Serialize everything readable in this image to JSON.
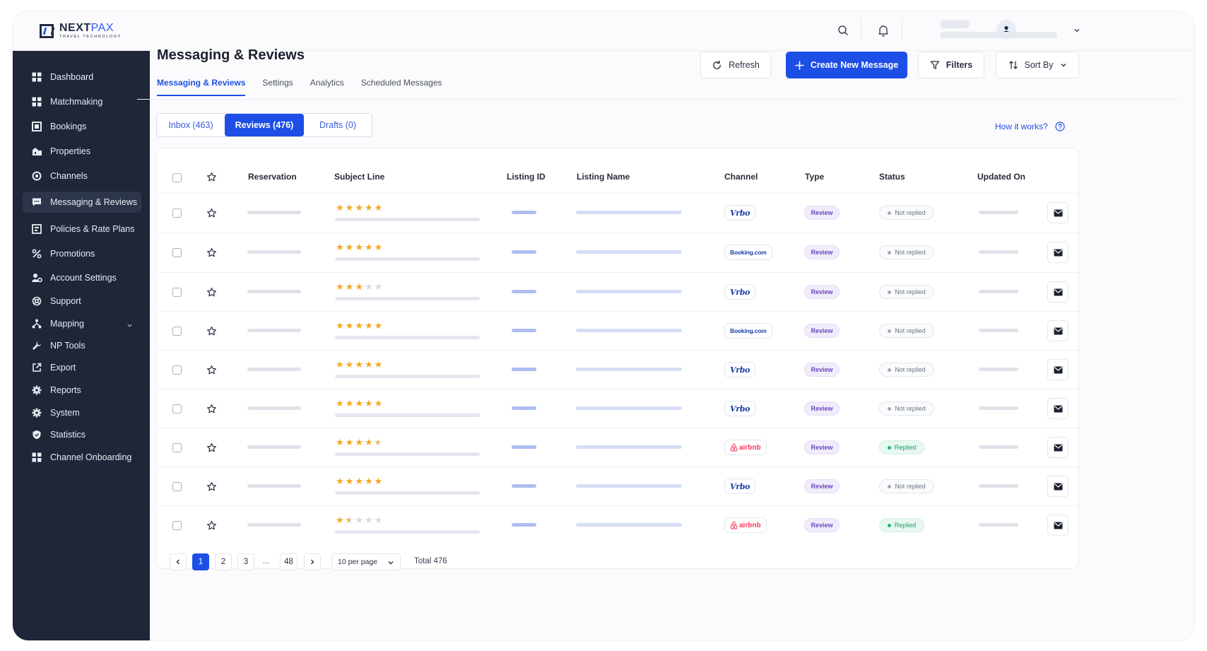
{
  "brand": {
    "name_bold": "NEXT",
    "name_light": "PAX",
    "tagline": "TRAVEL TECHNOLOGY",
    "accent": "#1d4ee6"
  },
  "sidebar": {
    "items": [
      {
        "label": "Dashboard",
        "icon": "grid-icon"
      },
      {
        "label": "Matchmaking",
        "icon": "grid-icon"
      },
      {
        "label": "Bookings",
        "icon": "book-icon"
      },
      {
        "label": "Properties",
        "icon": "building-icon"
      },
      {
        "label": "Channels",
        "icon": "channel-icon"
      },
      {
        "label": "Messaging & Reviews",
        "icon": "chat-icon"
      },
      {
        "label": "Policies & Rate Plans",
        "icon": "policy-icon"
      },
      {
        "label": "Promotions",
        "icon": "promo-icon"
      },
      {
        "label": "Account Settings",
        "icon": "account-gear-icon"
      },
      {
        "label": "Support",
        "icon": "support-icon"
      },
      {
        "label": "Mapping",
        "icon": "mapping-icon"
      },
      {
        "label": "NP Tools",
        "icon": "wrench-icon"
      },
      {
        "label": "Export",
        "icon": "export-icon"
      },
      {
        "label": "Reports",
        "icon": "gear-icon"
      },
      {
        "label": "System",
        "icon": "gear-icon"
      },
      {
        "label": "Statistics",
        "icon": "shield-icon"
      },
      {
        "label": "Channel Onboarding",
        "icon": "grid-icon"
      }
    ]
  },
  "header": {
    "title": "Messaging & Reviews",
    "tabs": [
      "Messaging & Reviews",
      "Settings",
      "Analytics",
      "Scheduled Messages"
    ],
    "refresh_label": "Refresh",
    "create_label": "Create New Message",
    "filters_label": "Filters",
    "sort_label": "Sort By"
  },
  "segments": [
    "Inbox (463)",
    "Reviews (476)",
    "Drafts (0)"
  ],
  "how_it_works": "How it works?",
  "table": {
    "columns": [
      "Reservation",
      "Subject Line",
      "Listing ID",
      "Listing Name",
      "Channel",
      "Type",
      "Status",
      "Updated On"
    ],
    "rows": [
      {
        "rating": 5,
        "channel": "vrbo",
        "channel_label": "Vrbo",
        "type": "Review",
        "status": "Not replied"
      },
      {
        "rating": 5,
        "channel": "booking",
        "channel_label": "Booking.com",
        "type": "Review",
        "status": "Not replied"
      },
      {
        "rating": 3,
        "channel": "vrbo",
        "channel_label": "Vrbo",
        "type": "Review",
        "status": "Not replied"
      },
      {
        "rating": 5,
        "channel": "booking",
        "channel_label": "Booking.com",
        "type": "Review",
        "status": "Not replied"
      },
      {
        "rating": 5,
        "channel": "vrbo",
        "channel_label": "Vrbo",
        "type": "Review",
        "status": "Not replied"
      },
      {
        "rating": 5,
        "channel": "vrbo",
        "channel_label": "Vrbo",
        "type": "Review",
        "status": "Not replied"
      },
      {
        "rating": 4.5,
        "channel": "airbnb",
        "channel_label": "airbnb",
        "type": "Review",
        "status": "Replied"
      },
      {
        "rating": 5,
        "channel": "vrbo",
        "channel_label": "Vrbo",
        "type": "Review",
        "status": "Not replied"
      },
      {
        "rating": 1.5,
        "channel": "airbnb",
        "channel_label": "airbnb",
        "type": "Review",
        "status": "Replied"
      }
    ]
  },
  "pagination": {
    "pages": [
      "1",
      "2",
      "3",
      "48"
    ],
    "ellipsis": "...",
    "per_page": "10 per page",
    "total": "Total 476"
  }
}
